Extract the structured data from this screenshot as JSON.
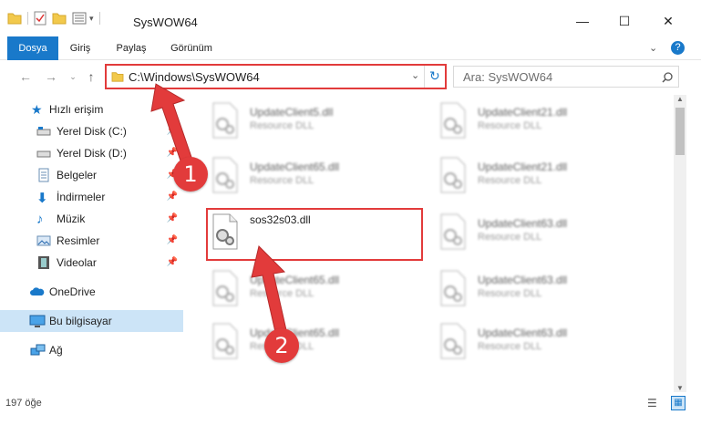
{
  "window": {
    "title": "SysWOW64",
    "minimize": "—",
    "maximize": "☐",
    "close": "✕"
  },
  "ribbon": {
    "tabs": [
      {
        "label": "Dosya"
      },
      {
        "label": "Giriş"
      },
      {
        "label": "Paylaş"
      },
      {
        "label": "Görünüm"
      }
    ],
    "help": "?"
  },
  "address": {
    "path": "C:\\Windows\\SysWOW64",
    "search_placeholder": "Ara: SysWOW64"
  },
  "sidebar": {
    "items": [
      {
        "label": "Hızlı erişim"
      },
      {
        "label": "Yerel Disk (C:)"
      },
      {
        "label": "Yerel Disk (D:)"
      },
      {
        "label": "Belgeler"
      },
      {
        "label": "İndirmeler"
      },
      {
        "label": "Müzik"
      },
      {
        "label": "Resimler"
      },
      {
        "label": "Videolar"
      },
      {
        "label": "OneDrive"
      },
      {
        "label": "Bu bilgisayar"
      },
      {
        "label": "Ağ"
      }
    ]
  },
  "files": [
    {
      "name": "UpdateClient5.dll",
      "type": "Resource DLL"
    },
    {
      "name": "UpdateClient21.dll",
      "type": "Resource DLL"
    },
    {
      "name": "UpdateClient65.dll",
      "type": "Resource DLL"
    },
    {
      "name": "UpdateClient21.dll",
      "type": "Resource DLL"
    },
    {
      "name": "sos32s03.dll",
      "type": ""
    },
    {
      "name": "UpdateClient63.dll",
      "type": "Resource DLL"
    },
    {
      "name": "UpdateClient65.dll",
      "type": "Resource DLL"
    },
    {
      "name": "UpdateClient63.dll",
      "type": "Resource DLL"
    },
    {
      "name": "UpdateClient65.dll",
      "type": "Resource DLL"
    },
    {
      "name": "UpdateClient63.dll",
      "type": "Resource DLL"
    }
  ],
  "status": {
    "count": "197 öğe"
  },
  "annotations": {
    "step1": "1",
    "step2": "2",
    "color": "#e23b3b"
  }
}
